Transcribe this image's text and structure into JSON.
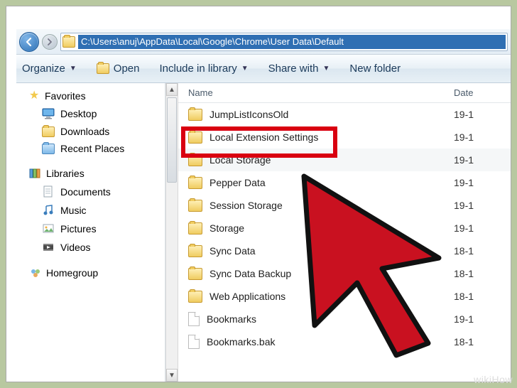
{
  "address_path": "C:\\Users\\anuj\\AppData\\Local\\Google\\Chrome\\User Data\\Default",
  "toolbar": {
    "organize": "Organize",
    "open": "Open",
    "include": "Include in library",
    "share": "Share with",
    "newfolder": "New folder"
  },
  "sidebar": {
    "favorites": "Favorites",
    "desktop": "Desktop",
    "downloads": "Downloads",
    "recent": "Recent Places",
    "libraries": "Libraries",
    "documents": "Documents",
    "music": "Music",
    "pictures": "Pictures",
    "videos": "Videos",
    "homegroup": "Homegroup"
  },
  "columns": {
    "name": "Name",
    "date": "Date"
  },
  "files": [
    {
      "name": "JumpListIconsOld",
      "date": "19-1",
      "type": "folder"
    },
    {
      "name": "Local Extension Settings",
      "date": "19-1",
      "type": "folder"
    },
    {
      "name": "Local Storage",
      "date": "19-1",
      "type": "folder",
      "highlight": true
    },
    {
      "name": "Pepper Data",
      "date": "19-1",
      "type": "folder"
    },
    {
      "name": "Session Storage",
      "date": "19-1",
      "type": "folder"
    },
    {
      "name": "Storage",
      "date": "19-1",
      "type": "folder"
    },
    {
      "name": "Sync Data",
      "date": "18-1",
      "type": "folder"
    },
    {
      "name": "Sync Data Backup",
      "date": "18-1",
      "type": "folder"
    },
    {
      "name": "Web Applications",
      "date": "18-1",
      "type": "folder"
    },
    {
      "name": "Bookmarks",
      "date": "19-1",
      "type": "file"
    },
    {
      "name": "Bookmarks.bak",
      "date": "18-1",
      "type": "file"
    }
  ],
  "watermark": "wikiHow"
}
